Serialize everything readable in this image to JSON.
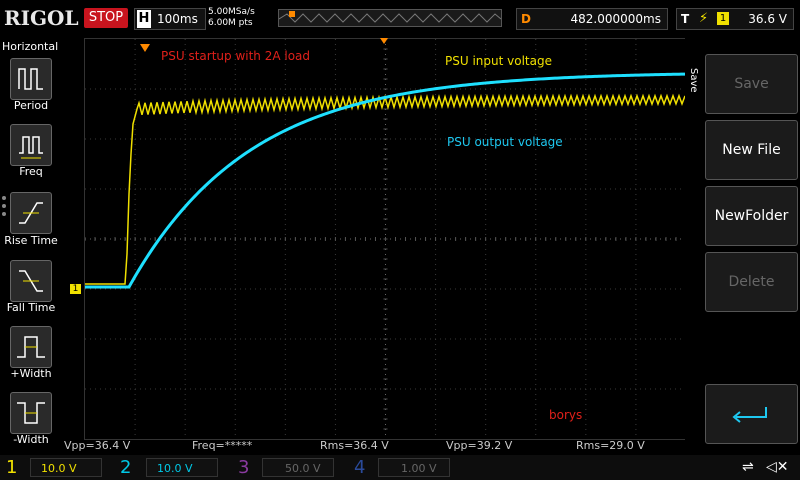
{
  "header": {
    "brand": "RIGOL",
    "run_state": "STOP",
    "horizontal_key": "H",
    "timebase": "100ms",
    "sample_rate": "5.00MSa/s",
    "memory_depth": "6.00M pts",
    "delay_key": "D",
    "delay_value": "482.000000ms",
    "trigger_key": "T",
    "trigger_channel": "1",
    "trigger_level": "36.6 V"
  },
  "left_panel": {
    "title": "Horizontal",
    "items": [
      {
        "label": "Period"
      },
      {
        "label": "Freq"
      },
      {
        "label": "Rise Time"
      },
      {
        "label": "Fall Time"
      },
      {
        "label": "+Width"
      },
      {
        "label": "-Width"
      }
    ]
  },
  "right_panel": {
    "side_label": "Save",
    "buttons": [
      {
        "label": "Save",
        "enabled": false
      },
      {
        "label": "New File",
        "enabled": true
      },
      {
        "label": "NewFolder",
        "enabled": true
      },
      {
        "label": "Delete",
        "enabled": false
      }
    ]
  },
  "annotations": {
    "startup": "PSU startup with 2A load",
    "input": "PSU input voltage",
    "output": "PSU output voltage",
    "author": "borys"
  },
  "ch1_marker": "1",
  "measurements": {
    "vpp1": "Vpp=36.4 V",
    "freq": "Freq=*****",
    "rms1": "Rms=36.4 V",
    "vpp2": "Vpp=39.2 V",
    "rms2": "Rms=29.0 V"
  },
  "channels": [
    {
      "num": "1",
      "scale": "10.0 V",
      "color": "#f0e000"
    },
    {
      "num": "2",
      "scale": "10.0 V",
      "color": "#00c8e6"
    },
    {
      "num": "3",
      "scale": "50.0 V",
      "color": "#8a3aa0"
    },
    {
      "num": "4",
      "scale": "1.00 V",
      "color": "#2a4a9a"
    }
  ],
  "colors": {
    "ch1": "#f0e000",
    "ch2": "#1ee0ff",
    "annotation_red": "#e0201a",
    "annotation_yellow": "#f0e000",
    "annotation_cyan": "#1ec8f0",
    "trigger_orange": "#ff8a00"
  }
}
